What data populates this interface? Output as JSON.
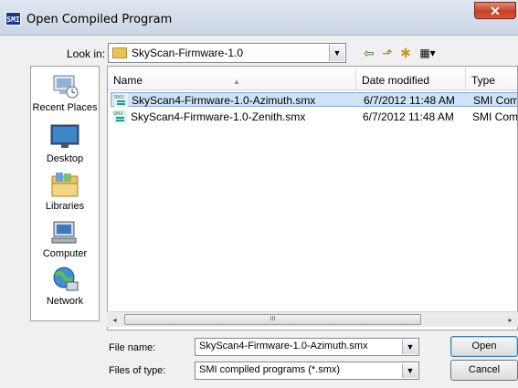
{
  "window": {
    "title": "Open Compiled Program",
    "app_icon_text": "SMI",
    "close_glyph": "✕"
  },
  "lookin": {
    "label": "Look in:",
    "underline_char": "i",
    "value": "SkyScan-Firmware-1.0"
  },
  "toolbar": {
    "back_glyph": "⇦",
    "up_glyph": "⬏",
    "new_folder_glyph": "✱",
    "views_glyph": "▦▾"
  },
  "places": [
    {
      "id": "recent",
      "label": "Recent Places",
      "icon": "recent-places-icon"
    },
    {
      "id": "desktop",
      "label": "Desktop",
      "icon": "desktop-icon"
    },
    {
      "id": "libraries",
      "label": "Libraries",
      "icon": "libraries-icon"
    },
    {
      "id": "computer",
      "label": "Computer",
      "icon": "computer-icon"
    },
    {
      "id": "network",
      "label": "Network",
      "icon": "network-icon"
    }
  ],
  "columns": {
    "name": "Name",
    "date": "Date modified",
    "type": "Type"
  },
  "files": [
    {
      "name": "SkyScan4-Firmware-1.0-Azimuth.smx",
      "date": "6/7/2012 11:48 AM",
      "type": "SMI Compiled",
      "selected": true
    },
    {
      "name": "SkyScan4-Firmware-1.0-Zenith.smx",
      "date": "6/7/2012 11:48 AM",
      "type": "SMI Compiled",
      "selected": false
    }
  ],
  "scroll": {
    "left_glyph": "◂",
    "right_glyph": "▸",
    "grip": "III"
  },
  "filename": {
    "label": "File name:",
    "value": "SkyScan4-Firmware-1.0-Azimuth.smx"
  },
  "filetype": {
    "label": "Files of type:",
    "value": "SMI compiled programs (*.smx)"
  },
  "buttons": {
    "open": "Open",
    "cancel": "Cancel"
  },
  "colors": {
    "selection": "#cfe3f8",
    "selection_border": "#84acdd",
    "close": "#c64025"
  }
}
